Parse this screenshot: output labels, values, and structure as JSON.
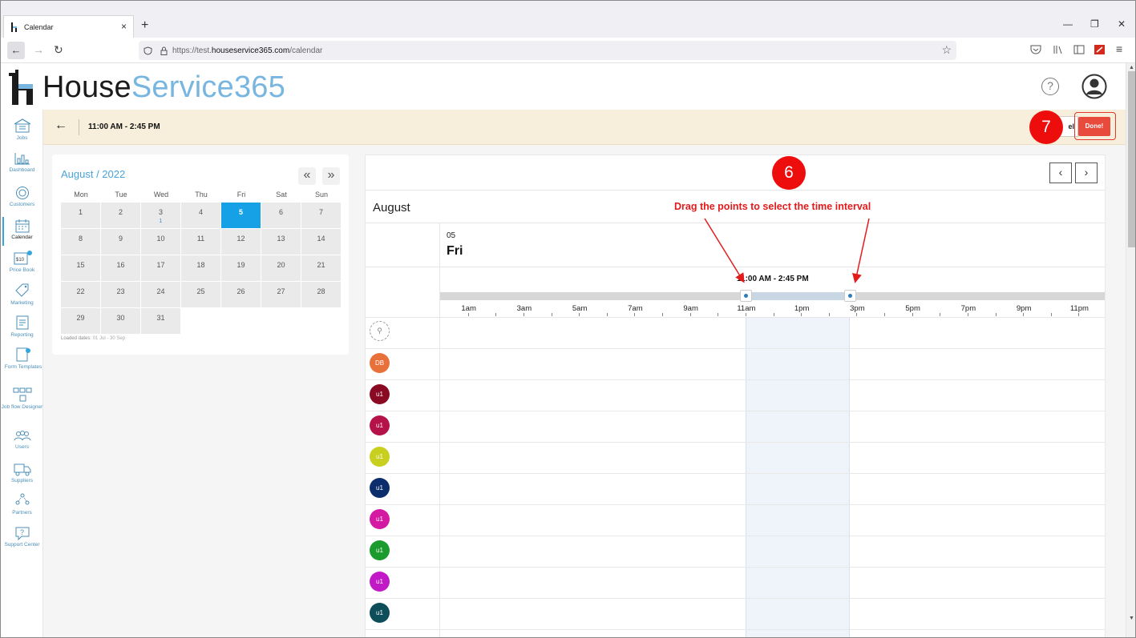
{
  "browser": {
    "tab_title": "Calendar",
    "tab_close": "×",
    "new_tab": "+",
    "url_scheme": "https://test.",
    "url_host": "houseservice365.com",
    "url_path": "/calendar"
  },
  "app": {
    "logo_part1": "House",
    "logo_part2": "Service365",
    "help": "?"
  },
  "sidebar": {
    "items": [
      {
        "label": "Jobs"
      },
      {
        "label": "Dashboard"
      },
      {
        "label": "Customers"
      },
      {
        "label": "Calendar"
      },
      {
        "label": "Price Book"
      },
      {
        "label": "Marketing"
      },
      {
        "label": "Reporting"
      },
      {
        "label": "Form Templates"
      },
      {
        "label": "Job flow Designer"
      },
      {
        "label": "Users"
      },
      {
        "label": "Suppliers"
      },
      {
        "label": "Partners"
      },
      {
        "label": "Support Center"
      }
    ]
  },
  "toolbar": {
    "time_range": "11:00 AM - 2:45 PM",
    "cancel_label": "el",
    "done_label": "Done!"
  },
  "minical": {
    "title": "August / 2022",
    "prev": "«",
    "next": "»",
    "dow": [
      "Mon",
      "Tue",
      "Wed",
      "Thu",
      "Fri",
      "Sat",
      "Sun"
    ],
    "weeks": [
      [
        "1",
        "2",
        "3",
        "4",
        "5",
        "6",
        "7"
      ],
      [
        "8",
        "9",
        "10",
        "11",
        "12",
        "13",
        "14"
      ],
      [
        "15",
        "16",
        "17",
        "18",
        "19",
        "20",
        "21"
      ],
      [
        "22",
        "23",
        "24",
        "25",
        "26",
        "27",
        "28"
      ],
      [
        "29",
        "30",
        "31",
        "",
        "",
        "",
        ""
      ]
    ],
    "selected_day": "5",
    "event_count_day": "3",
    "event_count": "1",
    "loaded_label": "Loaded dates:",
    "loaded_value": "01 Jul - 30 Sep"
  },
  "scheduler": {
    "month": "August",
    "day_number": "05",
    "day_name": "Fri",
    "range_label": "11:00 AM - 2:45 PM",
    "prev": "‹",
    "next": "›",
    "hours": [
      "1am",
      "3am",
      "5am",
      "7am",
      "9am",
      "11am",
      "1pm",
      "3pm",
      "5pm",
      "7pm",
      "9pm",
      "11pm"
    ],
    "selection_start_hour": 11,
    "selection_end_hour": 14.75,
    "resources": [
      {
        "initials": "DB",
        "color": "#e8703a"
      },
      {
        "initials": "u1",
        "color": "#8a0a23"
      },
      {
        "initials": "u1",
        "color": "#b5124a"
      },
      {
        "initials": "u1",
        "color": "#c9cf1f"
      },
      {
        "initials": "u1",
        "color": "#0c2d6b"
      },
      {
        "initials": "u1",
        "color": "#d41aa3"
      },
      {
        "initials": "u1",
        "color": "#1b9a2e"
      },
      {
        "initials": "u1",
        "color": "#c219c6"
      },
      {
        "initials": "u1",
        "color": "#0e4d5a"
      }
    ]
  },
  "annotations": {
    "step6": "6",
    "step7": "7",
    "instruction": "Drag the points to select the time interval"
  }
}
